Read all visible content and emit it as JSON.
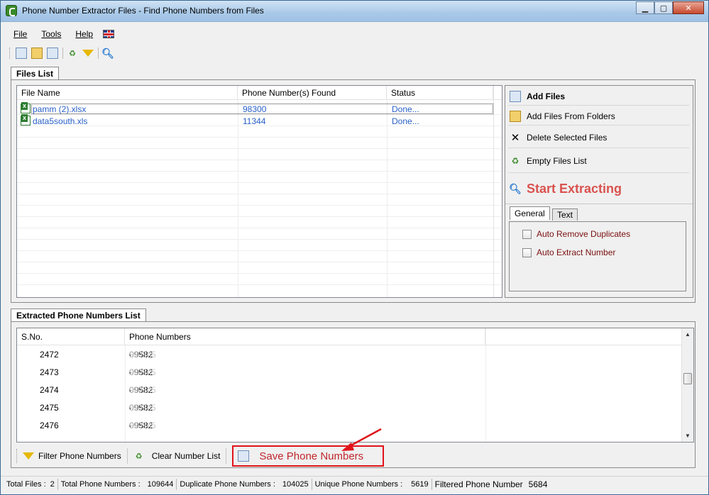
{
  "window": {
    "title": "Phone Number Extractor Files - Find Phone Numbers from Files",
    "minimize": "▁",
    "maximize": "▢",
    "close": "✕"
  },
  "menu": {
    "file": "File",
    "tools": "Tools",
    "help": "Help",
    "language_flag": "uk-flag-icon"
  },
  "toolbar": {
    "icons": [
      "add-files-icon",
      "add-folder-icon",
      "delete-icon",
      "empty-list-icon",
      "filter-icon",
      "search-icon"
    ]
  },
  "files_tab": {
    "label": "Files List"
  },
  "files_table": {
    "columns": [
      "File Name",
      "Phone Number(s) Found",
      "Status"
    ],
    "rows": [
      {
        "name": "pamm (2).xlsx",
        "found": "98300",
        "status": "Done..."
      },
      {
        "name": "data5south.xls",
        "found": "11344",
        "status": "Done..."
      }
    ]
  },
  "actions": {
    "add_files": "Add Files",
    "add_folders": "Add Files From Folders",
    "delete_selected": "Delete Selected Files",
    "empty_list": "Empty Files List",
    "start_extracting": "Start Extracting"
  },
  "options": {
    "tab_general": "General",
    "tab_text": "Text",
    "auto_remove_duplicates": "Auto Remove Duplicates",
    "auto_extract_number": "Auto Extract Number"
  },
  "extracted_tab": {
    "label": "Extracted Phone Numbers List"
  },
  "numbers_table": {
    "columns": [
      "S.No.",
      "Phone Numbers"
    ],
    "rows": [
      {
        "sno": "2472",
        "prefix": "09582",
        "hidden": "999345"
      },
      {
        "sno": "2473",
        "prefix": "09582",
        "hidden": "999345"
      },
      {
        "sno": "2474",
        "prefix": "09582",
        "hidden": "999345"
      },
      {
        "sno": "2475",
        "prefix": "09582",
        "hidden": "999345"
      },
      {
        "sno": "2476",
        "prefix": "09582",
        "hidden": "999345"
      }
    ]
  },
  "bottom_actions": {
    "filter": "Filter Phone Numbers",
    "clear": "Clear Number List",
    "save": "Save Phone Numbers"
  },
  "status": {
    "total_files_label": "Total Files :",
    "total_files": "2",
    "total_numbers_label": "Total Phone Numbers :",
    "total_numbers": "109644",
    "duplicate_label": "Duplicate Phone Numbers :",
    "duplicate": "104025",
    "unique_label": "Unique Phone Numbers :",
    "unique": "5619",
    "filtered_label": "Filtered Phone Number",
    "filtered": "5684"
  },
  "colors": {
    "accent_red": "#d9534f",
    "link_blue": "#2a60c8",
    "highlight_border": "#e0141a"
  }
}
